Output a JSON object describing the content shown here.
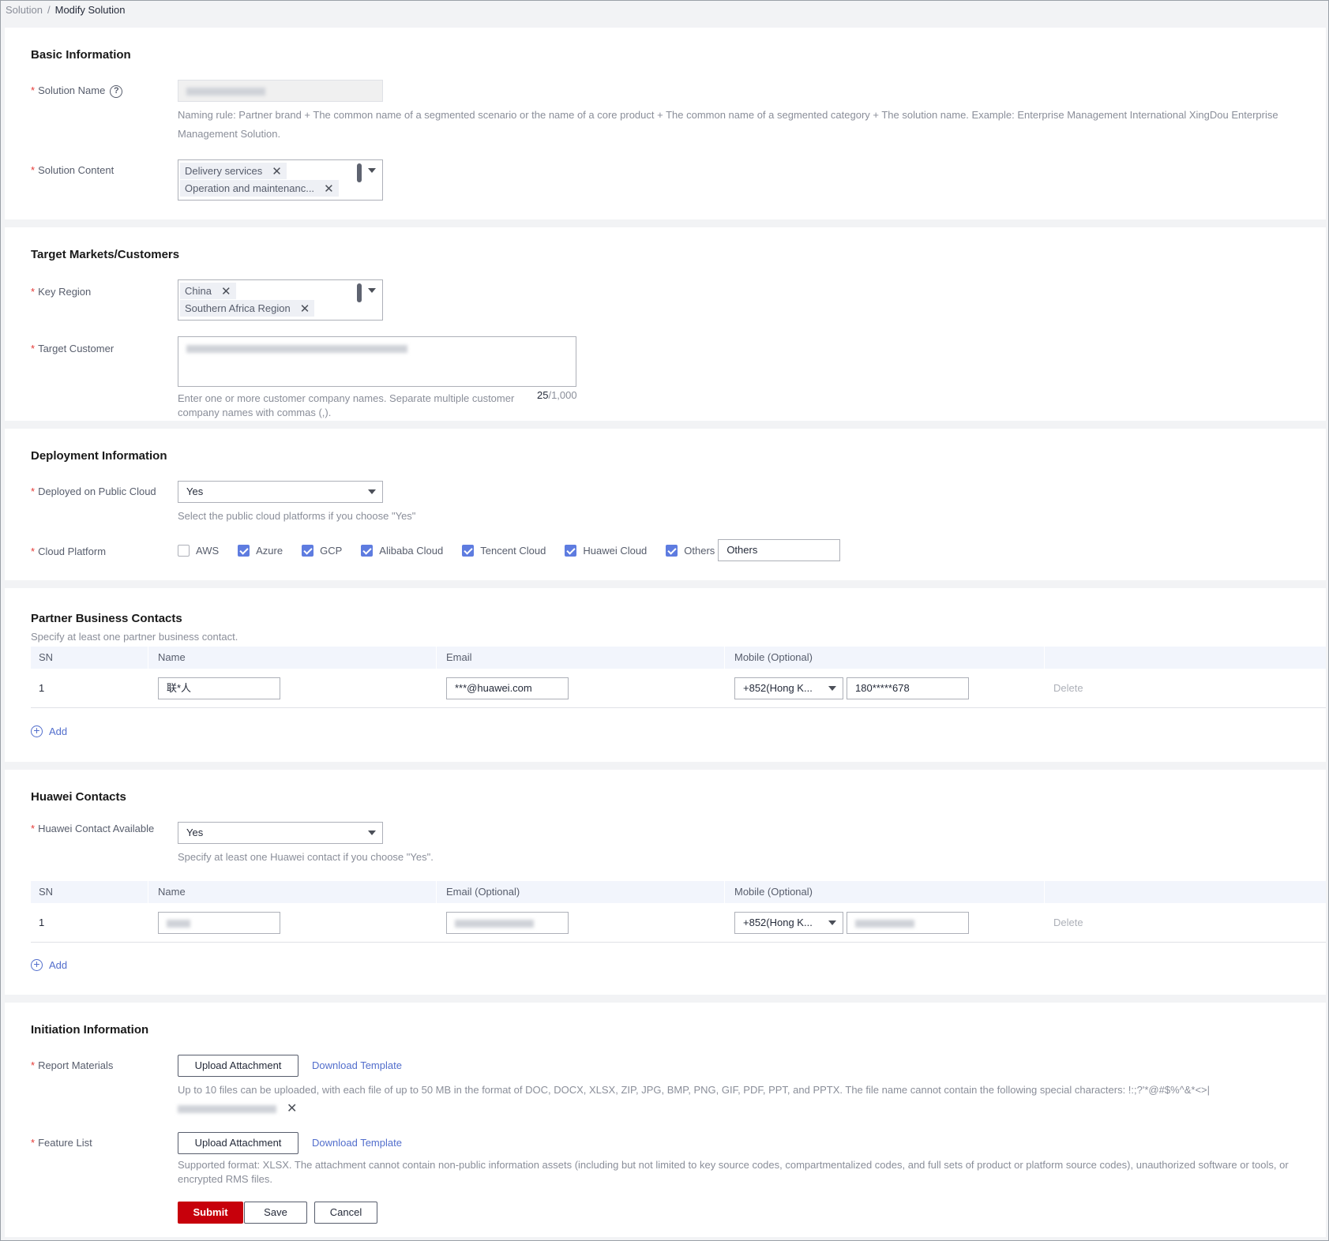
{
  "breadcrumb": {
    "root": "Solution",
    "separator": "/",
    "current": "Modify Solution"
  },
  "basic": {
    "title": "Basic Information",
    "solution_name_label": "Solution Name",
    "naming_rule": "Naming rule: Partner brand + The common name of a segmented scenario or the name of a core product + The common name of a segmented category + The solution name. Example: Enterprise Management International XingDou Enterprise Management Solution.",
    "solution_content_label": "Solution Content",
    "solution_content_tags": [
      "Delivery services",
      "Operation and maintenanc..."
    ]
  },
  "target": {
    "title": "Target Markets/Customers",
    "key_region_label": "Key Region",
    "key_region_tags": [
      "China",
      "Southern Africa Region"
    ],
    "target_customer_label": "Target Customer",
    "counter_current": "25",
    "counter_max": "/1,000",
    "hint": "Enter one or more customer company names. Separate multiple customer company names with commas (,)."
  },
  "deployment": {
    "title": "Deployment Information",
    "public_cloud_label": "Deployed on Public Cloud",
    "public_cloud_value": "Yes",
    "public_cloud_hint": "Select the public cloud platforms if you choose \"Yes\"",
    "cloud_platform_label": "Cloud Platform",
    "platforms": [
      {
        "label": "AWS",
        "checked": false
      },
      {
        "label": "Azure",
        "checked": true
      },
      {
        "label": "GCP",
        "checked": true
      },
      {
        "label": "Alibaba Cloud",
        "checked": true
      },
      {
        "label": "Tencent Cloud",
        "checked": true
      },
      {
        "label": "Huawei Cloud",
        "checked": true
      },
      {
        "label": "Others",
        "checked": true
      }
    ],
    "others_value": "Others"
  },
  "partner_contacts": {
    "title": "Partner Business Contacts",
    "subtitle": "Specify at least one partner business contact.",
    "columns": [
      "SN",
      "Name",
      "Email",
      "Mobile (Optional)"
    ],
    "rows": [
      {
        "sn": "1",
        "name": "联*人",
        "email": "***@huawei.com",
        "code": "+852(Hong K...",
        "mobile": "180*****678",
        "action": "Delete"
      }
    ],
    "add_label": "Add"
  },
  "huawei_contacts": {
    "title": "Huawei Contacts",
    "available_label": "Huawei Contact Available",
    "available_value": "Yes",
    "hint": "Specify at least one Huawei contact if you choose \"Yes\".",
    "columns": [
      "SN",
      "Name",
      "Email (Optional)",
      "Mobile (Optional)"
    ],
    "rows": [
      {
        "sn": "1",
        "code": "+852(Hong K...",
        "action": "Delete"
      }
    ],
    "add_label": "Add"
  },
  "initiation": {
    "title": "Initiation Information",
    "report_label": "Report Materials",
    "upload_label": "Upload Attachment",
    "download_label": "Download Template",
    "report_hint": "Up to 10 files can be uploaded, with each file of up to 50 MB in the format of DOC, DOCX, XLSX, ZIP, JPG, BMP, PNG, GIF, PDF, PPT, and PPTX. The file name cannot contain the following special characters: !:;?'*@#$%^&*<>|",
    "feature_label": "Feature List",
    "feature_upload_label": "Upload Attachment",
    "feature_download_label": "Download Template",
    "feature_hint": "Supported format: XLSX. The attachment cannot contain non-public information assets (including but not limited to key source codes, compartmentalized codes, and full sets of product or platform source codes), unauthorized software or tools, or encrypted RMS files."
  },
  "actions": {
    "submit": "Submit",
    "save": "Save",
    "cancel": "Cancel"
  },
  "colors": {
    "primary": "#c7000b",
    "link": "#526ecc",
    "checkbox": "#5e7ce0",
    "required": "#e53935"
  }
}
